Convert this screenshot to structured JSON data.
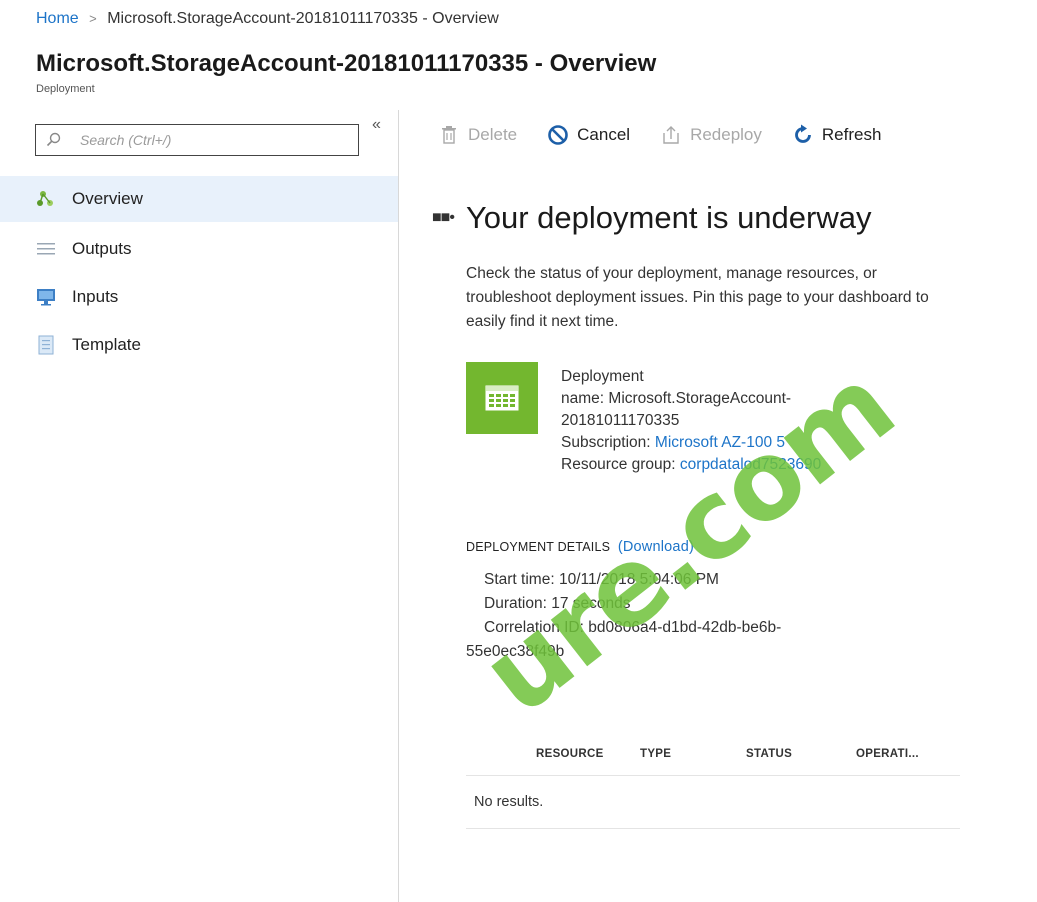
{
  "breadcrumb": {
    "home": "Home",
    "separator": ">",
    "current": "Microsoft.StorageAccount-20181011170335 - Overview"
  },
  "header": {
    "title": "Microsoft.StorageAccount-20181011170335 - Overview",
    "subtitle": "Deployment"
  },
  "sidebar": {
    "search_placeholder": "Search (Ctrl+/)",
    "collapse_glyph": "«",
    "items": [
      {
        "label": "Overview",
        "icon": "overview-icon",
        "active": true
      },
      {
        "label": "Outputs",
        "icon": "list-icon",
        "active": false
      },
      {
        "label": "Inputs",
        "icon": "monitor-icon",
        "active": false
      },
      {
        "label": "Template",
        "icon": "document-icon",
        "active": false
      }
    ]
  },
  "toolbar": {
    "delete": "Delete",
    "cancel": "Cancel",
    "redeploy": "Redeploy",
    "refresh": "Refresh"
  },
  "main": {
    "heading": "Your deployment is underway",
    "description": "Check the status of your deployment, manage resources, or troubleshoot deployment issues. Pin this page to your dashboard to easily find it next time.",
    "deployment": {
      "name_label": "Deployment",
      "name_key": "name:",
      "name_value_1": "Microsoft.StorageAccount-",
      "name_value_2": "20181011170335",
      "subscription_label": "Subscription:",
      "subscription_value": "Microsoft AZ-100 5",
      "resource_group_label": "Resource group:",
      "resource_group_value": "corpdatalod7523690"
    },
    "details": {
      "title": "DEPLOYMENT DETAILS",
      "download": "(Download)",
      "start_time_label": "Start time:",
      "start_time_value": "10/11/2018 5:04:06 PM",
      "duration_label": "Duration:",
      "duration_value": "17 seconds",
      "correlation_label": "Correlation ID:",
      "correlation_value_1": "bd0806a4-d1bd-42db-be6b-",
      "correlation_value_2": "55e0ec38f49b"
    },
    "table": {
      "columns": [
        "RESOURCE",
        "TYPE",
        "STATUS",
        "OPERATI..."
      ],
      "empty": "No results."
    }
  },
  "watermark": "ure.com",
  "colors": {
    "accent": "#1d74c8",
    "active_bg": "#e8f1fb",
    "tile_green": "#73b72f",
    "watermark_green": "#6fc33a"
  }
}
